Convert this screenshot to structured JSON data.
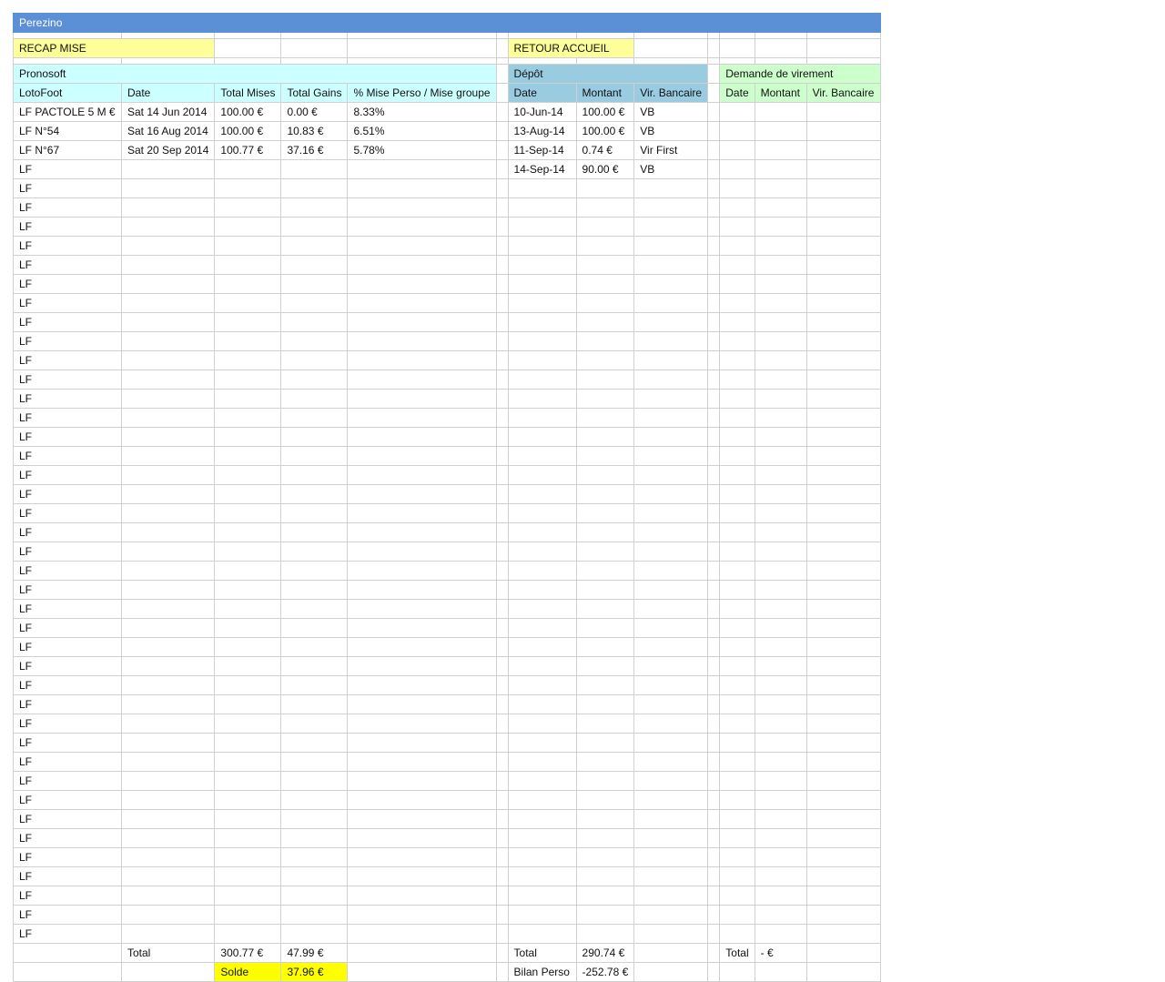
{
  "sheet_title": "Perezino",
  "nav": {
    "recap": "RECAP MISE",
    "retour": "RETOUR ACCUEIL"
  },
  "sections": {
    "pronosoft": "Pronosoft",
    "depot": "Dépôt",
    "virement": "Demande de virement"
  },
  "headers": {
    "lotofoot": "LotoFoot",
    "date": "Date",
    "total_mises": "Total Mises",
    "total_gains": "Total Gains",
    "pct": "% Mise Perso / Mise groupe",
    "depot_date": "Date",
    "depot_montant": "Montant",
    "depot_vir": "Vir. Bancaire",
    "dv_date": "Date",
    "dv_montant": "Montant",
    "dv_vir": "Vir. Bancaire"
  },
  "rows": [
    {
      "lf": "LF PACTOLE 5 M €",
      "date": "Sat 14 Jun 2014",
      "mises": "100.00 €",
      "gains": "0.00 €",
      "pct": "8.33%",
      "d_date": "10-Jun-14",
      "d_montant": "100.00 €",
      "d_vir": "VB"
    },
    {
      "lf": "LF N°54",
      "date": "Sat 16 Aug 2014",
      "mises": "100.00 €",
      "gains": "10.83 €",
      "pct": "6.51%",
      "d_date": "13-Aug-14",
      "d_montant": "100.00 €",
      "d_vir": "VB"
    },
    {
      "lf": "LF N°67",
      "date": "Sat 20 Sep 2014",
      "mises": "100.77 €",
      "gains": "37.16 €",
      "pct": "5.78%",
      "d_date": "11-Sep-14",
      "d_montant": "0.74 €",
      "d_vir": "Vir First"
    },
    {
      "lf": "LF",
      "d_date": "14-Sep-14",
      "d_montant": "90.00 €",
      "d_vir": "VB"
    },
    {
      "lf": "LF"
    },
    {
      "lf": "LF"
    },
    {
      "lf": "LF"
    },
    {
      "lf": "LF"
    },
    {
      "lf": "LF"
    },
    {
      "lf": "LF"
    },
    {
      "lf": "LF"
    },
    {
      "lf": "LF"
    },
    {
      "lf": "LF"
    },
    {
      "lf": "LF"
    },
    {
      "lf": "LF"
    },
    {
      "lf": "LF"
    },
    {
      "lf": "LF"
    },
    {
      "lf": "LF"
    },
    {
      "lf": "LF"
    },
    {
      "lf": "LF"
    },
    {
      "lf": "LF"
    },
    {
      "lf": "LF"
    },
    {
      "lf": "LF"
    },
    {
      "lf": "LF"
    },
    {
      "lf": "LF"
    },
    {
      "lf": "LF"
    },
    {
      "lf": "LF"
    },
    {
      "lf": "LF"
    },
    {
      "lf": "LF"
    },
    {
      "lf": "LF"
    },
    {
      "lf": "LF"
    },
    {
      "lf": "LF"
    },
    {
      "lf": "LF"
    },
    {
      "lf": "LF"
    },
    {
      "lf": "LF"
    },
    {
      "lf": "LF"
    },
    {
      "lf": "LF"
    },
    {
      "lf": "LF"
    },
    {
      "lf": "LF"
    },
    {
      "lf": "LF"
    },
    {
      "lf": "LF"
    },
    {
      "lf": "LF"
    },
    {
      "lf": "LF"
    },
    {
      "lf": "LF"
    }
  ],
  "totals": {
    "label": "Total",
    "mises": "300.77 €",
    "gains": "47.99 €",
    "depot_label": "Total",
    "depot_montant": "290.74 €",
    "dv_label": "Total",
    "dv_montant": "- €"
  },
  "solde": {
    "label": "Solde",
    "value": "37.96 €",
    "bilan_label": "Bilan Perso",
    "bilan_value": "-252.78 €"
  }
}
